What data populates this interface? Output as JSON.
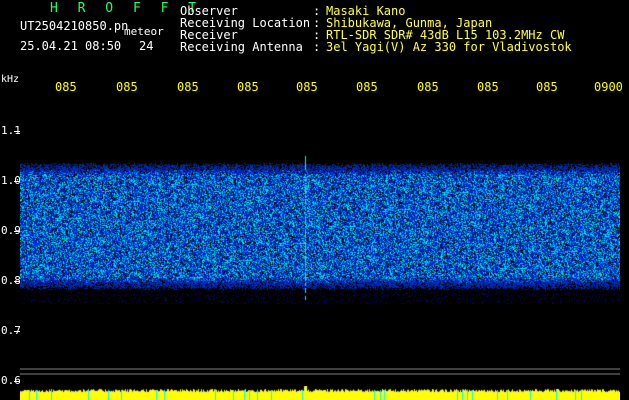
{
  "header": {
    "brand": "H R O F F T",
    "filename": "UT2504210850.pn",
    "mode": "meteor",
    "datetime": "25.04.21 08:50",
    "count": "24",
    "info": [
      {
        "label": "Observer",
        "value": "Masaki Kano"
      },
      {
        "label": "Receiving Location",
        "value": "Shibukawa, Gunma, Japan"
      },
      {
        "label": "Receiver",
        "value": "RTL-SDR SDR# 43dB L15 103.2MHz CW"
      },
      {
        "label": "Receiving Antenna",
        "value": "3el Yagi(V) Az 330 for Vladivostok"
      }
    ],
    "separator": ":"
  },
  "axis": {
    "unit": "kHz",
    "time_ticks": [
      "085",
      "085",
      "085",
      "085",
      "085",
      "085",
      "085",
      "085",
      "085",
      "0900"
    ],
    "freq_ticks": [
      "1.1",
      "1.0",
      "0.9",
      "0.8",
      "0.7",
      "0.6"
    ]
  },
  "colors": {
    "brand": "#22ff66",
    "text": "#ffffff",
    "value_text": "#ffff44",
    "tick_text": "#ffff00",
    "cyan": "#00ffff",
    "spectrum_low": "#0010a0",
    "spectrum_high": "#00ffd0",
    "baseline": "#ffff00"
  },
  "spectrogram": {
    "band_low_khz": 0.78,
    "band_high_khz": 1.04,
    "meteor_trace_minute": 4.7
  }
}
